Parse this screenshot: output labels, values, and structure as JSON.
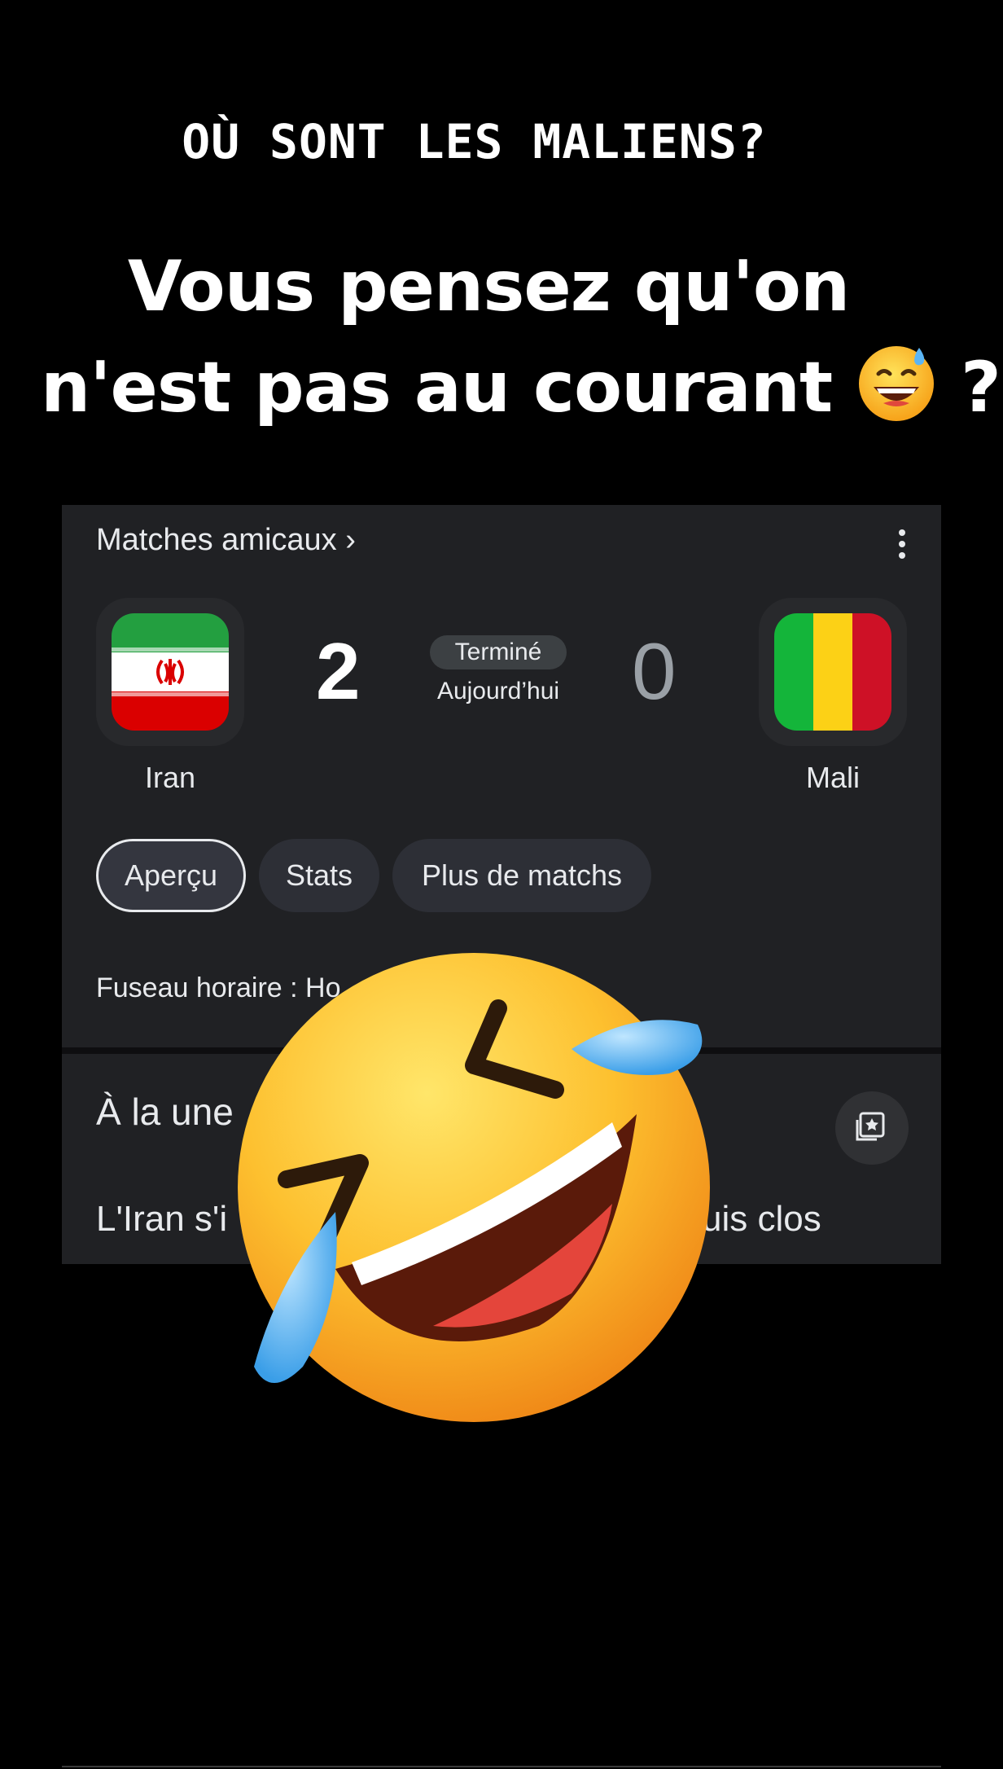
{
  "overlay": {
    "headline": "OÙ SONT LES MALIENS?",
    "caption_line1": "Vous pensez qu'on",
    "caption_line2": "n'est pas au courant",
    "caption_suffix": "?",
    "caption_emoji": "grinning-face-with-sweat-emoji",
    "center_emoji": "rolling-on-the-floor-laughing-emoji"
  },
  "card": {
    "header": "Matches amicaux ›",
    "menu_icon": "more-vert-icon",
    "home": {
      "name": "Iran",
      "score": "2",
      "flag": "iran-flag"
    },
    "away": {
      "name": "Mali",
      "score": "0",
      "flag": "mali-flag"
    },
    "status": "Terminé",
    "date": "Aujourd’hui",
    "tabs": [
      {
        "label": "Aperçu",
        "active": true
      },
      {
        "label": "Stats",
        "active": false
      },
      {
        "label": "Plus de matchs",
        "active": false
      }
    ],
    "timezone": "Fuseau horaire : Ho",
    "news": {
      "title": "À la une",
      "icon": "news-collection-icon",
      "item_left": "L'Iran s'i",
      "item_right": "uis clos"
    }
  },
  "colors": {
    "background": "#000000",
    "card": "#202124",
    "text": "#e8eaed",
    "iran_green": "#239f40",
    "iran_red": "#da0000",
    "mali_green": "#14b53a",
    "mali_yellow": "#fcd116",
    "mali_red": "#ce1126"
  }
}
